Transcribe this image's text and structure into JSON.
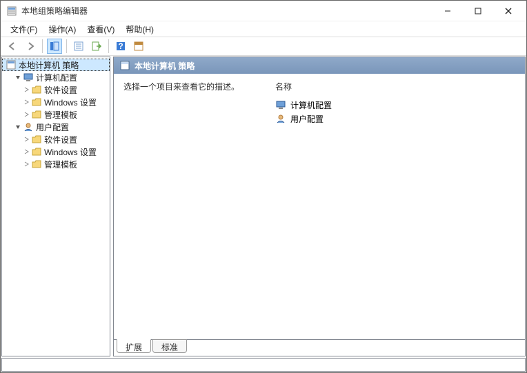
{
  "window": {
    "title": "本地组策略编辑器"
  },
  "menu": {
    "file": "文件(F)",
    "action": "操作(A)",
    "view": "查看(V)",
    "help": "帮助(H)"
  },
  "tree": {
    "root": "本地计算机 策略",
    "computer": "计算机配置",
    "c_soft": "软件设置",
    "c_win": "Windows 设置",
    "c_admin": "管理模板",
    "user": "用户配置",
    "u_soft": "软件设置",
    "u_win": "Windows 设置",
    "u_admin": "管理模板"
  },
  "detail": {
    "header": "本地计算机 策略",
    "description": "选择一个项目来查看它的描述。",
    "col_name": "名称",
    "items": {
      "comp": "计算机配置",
      "user": "用户配置"
    }
  },
  "tabs": {
    "ext": "扩展",
    "std": "标准"
  }
}
